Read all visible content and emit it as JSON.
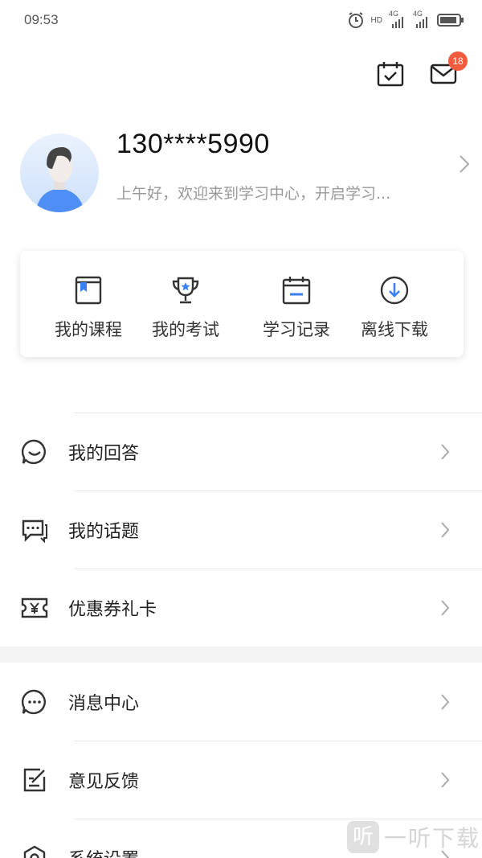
{
  "status_bar": {
    "time": "09:53",
    "network_1": "4G",
    "network_2": "4G",
    "hd": "HD"
  },
  "header": {
    "message_badge": "18"
  },
  "profile": {
    "phone": "130****5990",
    "greeting": "上午好，欢迎来到学习中心，开启学习..."
  },
  "quick_actions": [
    {
      "label": "我的课程",
      "icon": "course-book-icon"
    },
    {
      "label": "我的考试",
      "icon": "trophy-icon"
    },
    {
      "label": "学习记录",
      "icon": "calendar-record-icon"
    },
    {
      "label": "离线下载",
      "icon": "download-icon"
    }
  ],
  "menu_group_1": [
    {
      "label": "我的回答",
      "icon": "chat-bubble-icon"
    },
    {
      "label": "我的话题",
      "icon": "topic-icon"
    },
    {
      "label": "优惠券礼卡",
      "icon": "coupon-icon"
    }
  ],
  "menu_group_2": [
    {
      "label": "消息中心",
      "icon": "message-center-icon"
    },
    {
      "label": "意见反馈",
      "icon": "feedback-icon"
    },
    {
      "label": "系统设置",
      "icon": "settings-icon"
    }
  ],
  "watermark": {
    "text": "一听下载",
    "logo_char": "听"
  },
  "colors": {
    "badge": "#ef5b3d",
    "accent_blue": "#3b7ff0"
  }
}
